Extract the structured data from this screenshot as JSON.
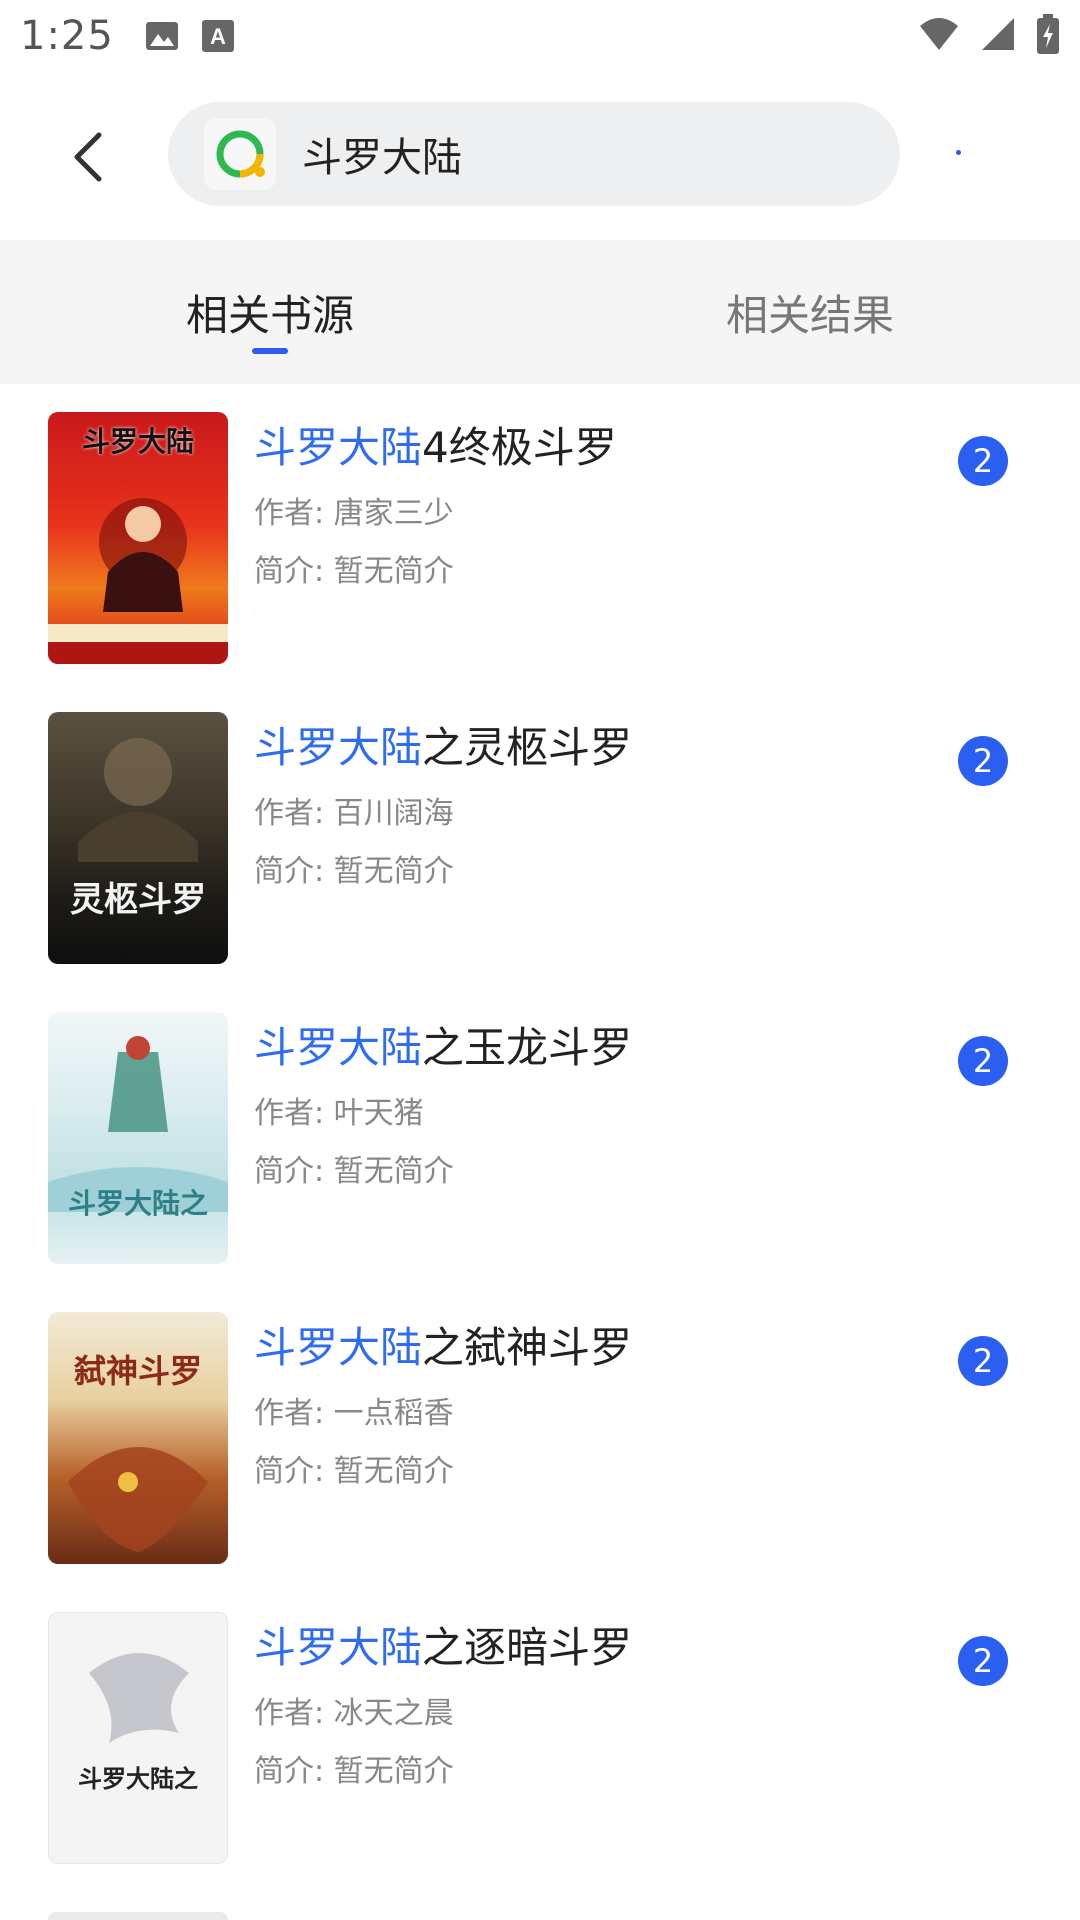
{
  "status_bar": {
    "time": "1:25"
  },
  "header": {
    "query": "斗罗大陆"
  },
  "tabs": [
    {
      "label": "相关书源",
      "active": true
    },
    {
      "label": "相关结果",
      "active": false
    }
  ],
  "books": [
    {
      "highlight": "斗罗大陆",
      "rest": "4终极斗罗",
      "author": "作者: 唐家三少",
      "intro": "简介: 暂无简介",
      "count": "2",
      "cover_text": "斗罗大陆"
    },
    {
      "highlight": "斗罗大陆",
      "rest": "之灵柩斗罗",
      "author": "作者: 百川阔海",
      "intro": "简介: 暂无简介",
      "count": "2",
      "cover_text": "灵柩斗罗"
    },
    {
      "highlight": "斗罗大陆",
      "rest": "之玉龙斗罗",
      "author": "作者: 叶天猪",
      "intro": "简介: 暂无简介",
      "count": "2",
      "cover_text": "斗罗大陆之"
    },
    {
      "highlight": "斗罗大陆",
      "rest": "之弑神斗罗",
      "author": "作者: 一点稻香",
      "intro": "简介: 暂无简介",
      "count": "2",
      "cover_text": "弑神斗罗"
    },
    {
      "highlight": "斗罗大陆",
      "rest": "之逐暗斗罗",
      "author": "作者: 冰天之晨",
      "intro": "简介: 暂无简介",
      "count": "2",
      "cover_text": "斗罗大陆之"
    }
  ],
  "colors": {
    "accent": "#2f6df0",
    "badge": "#2a5ff2"
  }
}
